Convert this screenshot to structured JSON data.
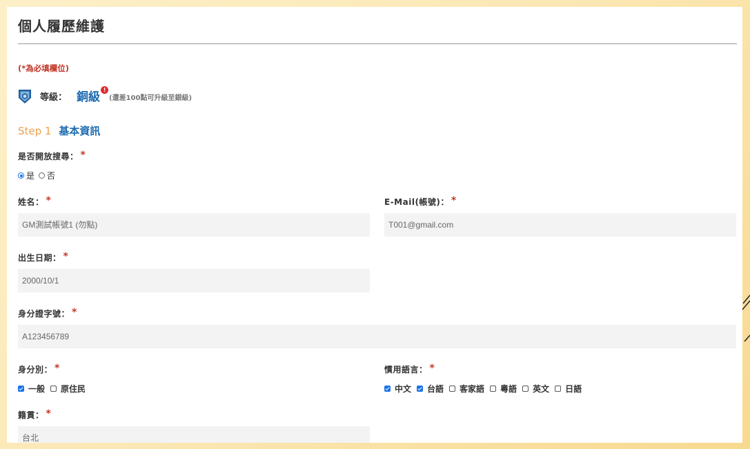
{
  "page": {
    "title": "個人履歷維護",
    "required_note": "(*為必填欄位)"
  },
  "level": {
    "label": "等級：",
    "value": "銅級",
    "badge": "!",
    "hint": "(還差100點可升級至銀級)",
    "icon": "shield-badge-icon"
  },
  "step": {
    "number": "Step 1",
    "name": "基本資訊"
  },
  "required_mark": "*",
  "searchable": {
    "label": "是否開放搜尋：",
    "options": [
      "是",
      "否"
    ],
    "selected": "是"
  },
  "name": {
    "label": "姓名：",
    "value": "GM測試帳號1 (勿點)"
  },
  "email": {
    "label": "E-Mail(帳號)：",
    "value": "T001@gmail.com"
  },
  "birthdate": {
    "label": "出生日期：",
    "value": "2000/10/1"
  },
  "id_number": {
    "label": "身分證字號：",
    "value": "A123456789"
  },
  "identity": {
    "label": "身分別：",
    "options": [
      {
        "label": "一般",
        "checked": true
      },
      {
        "label": "原住民",
        "checked": false
      }
    ]
  },
  "language": {
    "label": "慣用語言：",
    "options": [
      {
        "label": "中文",
        "checked": true
      },
      {
        "label": "台語",
        "checked": true
      },
      {
        "label": "客家語",
        "checked": false
      },
      {
        "label": "粵語",
        "checked": false
      },
      {
        "label": "英文",
        "checked": false
      },
      {
        "label": "日語",
        "checked": false
      }
    ]
  },
  "native_place": {
    "label": "籍貫：",
    "value": "台北"
  },
  "colors": {
    "accent_blue": "#1e6bb0",
    "step_orange": "#f0a04b",
    "required_red": "#c0392b",
    "checkbox_blue": "#1a73e8"
  }
}
